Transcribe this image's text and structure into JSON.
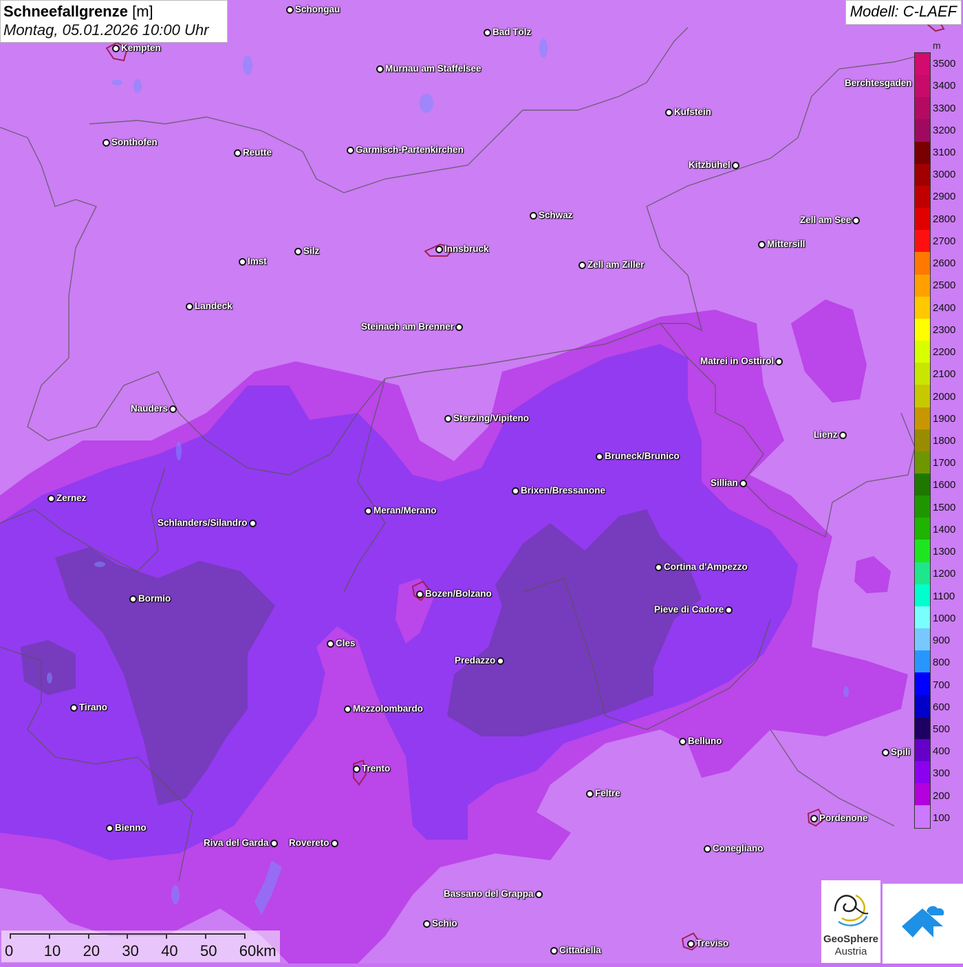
{
  "title": {
    "main_bold": "Schneefallgrenze",
    "main_unit": "[m]",
    "subtitle": "Montag, 05.01.2026 10:00 Uhr"
  },
  "model": "Modell: C-LAEF",
  "legend": {
    "unit": "m",
    "ticks": [
      "3500",
      "3400",
      "3300",
      "3200",
      "3100",
      "3000",
      "2900",
      "2800",
      "2700",
      "2600",
      "2500",
      "2400",
      "2300",
      "2200",
      "2100",
      "2000",
      "1900",
      "1800",
      "1700",
      "1600",
      "1500",
      "1400",
      "1300",
      "1200",
      "1100",
      "1000",
      "900",
      "800",
      "700",
      "600",
      "500",
      "400",
      "300",
      "200",
      "100"
    ],
    "colors": [
      "#d40a6e",
      "#c80a69",
      "#b40a62",
      "#a00a5e",
      "#780000",
      "#a00000",
      "#c00000",
      "#e00000",
      "#ff1010",
      "#ff7800",
      "#ffa000",
      "#ffc800",
      "#ffff00",
      "#d8ff00",
      "#c8e600",
      "#c8c800",
      "#c89600",
      "#9a8c00",
      "#6e9600",
      "#1e7800",
      "#1e9600",
      "#1eb400",
      "#1ee61e",
      "#1ee68c",
      "#00ffcc",
      "#7affff",
      "#78c8ff",
      "#2896ff",
      "#0000ff",
      "#0000c8",
      "#1e0064",
      "#6400c8",
      "#8c00f0",
      "#b400dc",
      "#cc78ff"
    ]
  },
  "cities": [
    {
      "name": "Schongau",
      "dot": "left"
    },
    {
      "name": "Bad Tölz",
      "dot": "left"
    },
    {
      "name": "Kempten",
      "dot": "left"
    },
    {
      "name": "Murnau am Staffelsee",
      "dot": "left"
    },
    {
      "name": "Berchtesgaden",
      "dot": "none"
    },
    {
      "name": "Kufstein",
      "dot": "left"
    },
    {
      "name": "Sonthofen",
      "dot": "left"
    },
    {
      "name": "Reutte",
      "dot": "left"
    },
    {
      "name": "Garmisch-Partenkirchen",
      "dot": "left"
    },
    {
      "name": "Kitzbühel",
      "dot": "right"
    },
    {
      "name": "Schwaz",
      "dot": "left"
    },
    {
      "name": "Zell am See",
      "dot": "right"
    },
    {
      "name": "Innsbruck",
      "dot": "left"
    },
    {
      "name": "Silz",
      "dot": "left"
    },
    {
      "name": "Imst",
      "dot": "left"
    },
    {
      "name": "Mittersill",
      "dot": "left"
    },
    {
      "name": "Zell am Ziller",
      "dot": "left"
    },
    {
      "name": "Landeck",
      "dot": "left"
    },
    {
      "name": "Steinach am Brenner",
      "dot": "right"
    },
    {
      "name": "Matrei in Osttirol",
      "dot": "right"
    },
    {
      "name": "Nauders",
      "dot": "right"
    },
    {
      "name": "Sterzing/Vipiteno",
      "dot": "left"
    },
    {
      "name": "Lienz",
      "dot": "right"
    },
    {
      "name": "Bruneck/Brunico",
      "dot": "left"
    },
    {
      "name": "Sillian",
      "dot": "right"
    },
    {
      "name": "Brixen/Bressanone",
      "dot": "left"
    },
    {
      "name": "Zernez",
      "dot": "left"
    },
    {
      "name": "Meran/Merano",
      "dot": "left"
    },
    {
      "name": "Schlanders/Silandro",
      "dot": "right"
    },
    {
      "name": "Cortina d'Ampezzo",
      "dot": "left"
    },
    {
      "name": "Bozen/Bolzano",
      "dot": "left"
    },
    {
      "name": "Bormio",
      "dot": "left"
    },
    {
      "name": "Pieve di Cadore",
      "dot": "right"
    },
    {
      "name": "Cles",
      "dot": "left"
    },
    {
      "name": "Predazzo",
      "dot": "right"
    },
    {
      "name": "Tirano",
      "dot": "left"
    },
    {
      "name": "Mezzolombardo",
      "dot": "left"
    },
    {
      "name": "Belluno",
      "dot": "left"
    },
    {
      "name": "Spili",
      "dot": "left"
    },
    {
      "name": "Trento",
      "dot": "left"
    },
    {
      "name": "Feltre",
      "dot": "left"
    },
    {
      "name": "Pordenone",
      "dot": "left"
    },
    {
      "name": "Bienno",
      "dot": "left"
    },
    {
      "name": "Riva del Garda",
      "dot": "right"
    },
    {
      "name": "Rovereto",
      "dot": "right"
    },
    {
      "name": "Conegliano",
      "dot": "left"
    },
    {
      "name": "Bassano del Grappa",
      "dot": "right"
    },
    {
      "name": "Schio",
      "dot": "left"
    },
    {
      "name": "Treviso",
      "dot": "left"
    },
    {
      "name": "Cittadella",
      "dot": "left"
    }
  ],
  "scalebar": {
    "labels": [
      "0",
      "10",
      "20",
      "30",
      "40",
      "50",
      "60km"
    ]
  },
  "logo": {
    "line1": "GeoSphere",
    "line2": "Austria"
  }
}
